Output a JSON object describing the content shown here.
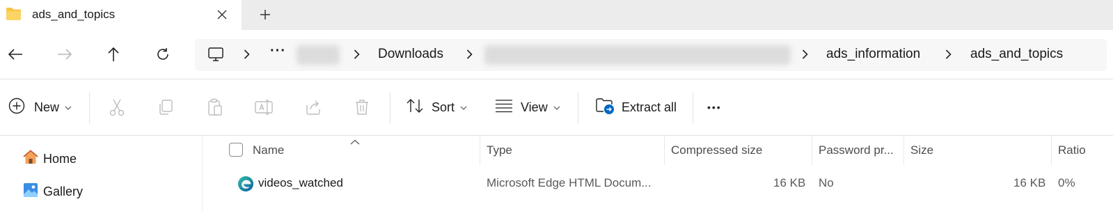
{
  "tab": {
    "title": "ads_and_topics",
    "close_icon": "close-icon",
    "newtab_icon": "plus-icon"
  },
  "nav": {
    "back": "arrow-left-icon",
    "forward": "arrow-right-icon",
    "up": "arrow-up-icon",
    "refresh": "refresh-icon"
  },
  "breadcrumb": {
    "root_icon": "this-pc-icon",
    "more": "···",
    "items": [
      "Downloads",
      "ads_information",
      "ads_and_topics"
    ]
  },
  "toolbar": {
    "new_label": "New",
    "sort_label": "Sort",
    "view_label": "View",
    "extract_label": "Extract all",
    "more_label": "•••",
    "disabled_icons": [
      "cut-icon",
      "copy-icon",
      "paste-icon",
      "rename-icon",
      "share-icon",
      "delete-icon"
    ]
  },
  "sidebar": {
    "items": [
      {
        "label": "Home",
        "icon": "home-icon"
      },
      {
        "label": "Gallery",
        "icon": "gallery-icon"
      }
    ]
  },
  "table": {
    "columns": [
      "Name",
      "Type",
      "Compressed size",
      "Password pr...",
      "Size",
      "Ratio"
    ],
    "rows": [
      {
        "icon": "edge-icon",
        "name": "videos_watched",
        "type": "Microsoft Edge HTML Docum...",
        "compressed_size": "16 KB",
        "password": "No",
        "size": "16 KB",
        "ratio": "0%"
      }
    ]
  },
  "colors": {
    "accent": "#0067c0",
    "folder": "#f8c541",
    "tabstrip_bg": "#ececec"
  }
}
